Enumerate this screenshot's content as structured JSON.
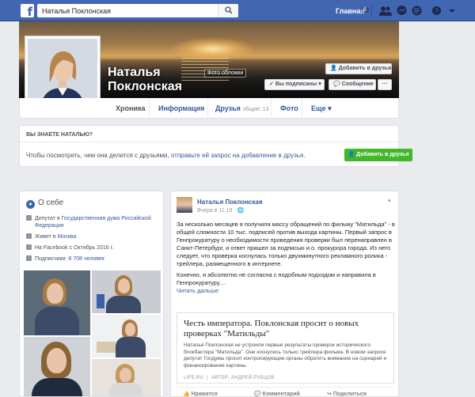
{
  "topbar": {
    "logo": "f",
    "search_value": "Наталья Поклонская",
    "home_label": "Главная",
    "home_count": "6"
  },
  "profile": {
    "name": "Наталья Поклонская",
    "cover_photo_label": "Фото обложки",
    "add_friend": "Добавить в друзья",
    "subscribed": "Вы подписаны",
    "message": "Сообщение",
    "more": "···"
  },
  "tabs": [
    {
      "label": "Хроника",
      "active": true
    },
    {
      "label": "Информация"
    },
    {
      "label": "Друзья",
      "sub": "общие: 13"
    },
    {
      "label": "Фото"
    },
    {
      "label": "Еще"
    }
  ],
  "know": {
    "title": "ВЫ ЗНАЕТЕ НАТАЛЬЮ?",
    "text_prefix": "Чтобы посмотреть, чем она делится с друзьями, ",
    "text_link": "отправьте ей запрос на добавление в друзья.",
    "button": "Добавить в друзья"
  },
  "about": {
    "title": "О себе",
    "items": [
      {
        "prefix": "Депутат в ",
        "link": "Государственная дума Российской Федерации"
      },
      {
        "prefix": "Живет в ",
        "link": "Москва"
      },
      {
        "prefix": "На Facebook с Октябрь 2016 г.",
        "link": ""
      },
      {
        "prefix": "Подписчики: ",
        "link": "8 708 человек"
      }
    ]
  },
  "post": {
    "author": "Наталья Поклонская",
    "time": "Вчера в 11:19 · ",
    "paragraph1": "За несколько месяцев я получила массу обращений по фильму \"Матильда\" - в общей сложности 10 тыс. подписей против выхода картины. Первый запрос в Генпрокуратуру о необходимости проведения проверки был перенаправлен в Санкт-Петербург, и ответ пришел за подписью и.о. прокурора города. Из него следует, что проверка коснулась только двухминутного рекламного ролика - трейлера, размещенного в интернете.",
    "paragraph2": "Конечно, я абсолютно не согласна с подобным подходом и направила в Генпрокуратуру....",
    "read_more": "Читать дальше",
    "link_title": "Честь императора. Поклонская просит о новых проверках \"Матильды\"",
    "link_desc": "Наталья Поклонская не устроили первые результаты проверок исторического блокбастера \"Матильда\". Они коснулись только трейлера фильма. В новом запросе депутат Госдумы просит контролирующие органы обратить внимание на сценарий и финансирование картины.",
    "link_source": "LIFE.RU",
    "link_author": "АВТОР: АНДРЕЙ РУБЦОВ",
    "actions": [
      "Нравится",
      "Комментарий",
      "Поделиться"
    ]
  }
}
